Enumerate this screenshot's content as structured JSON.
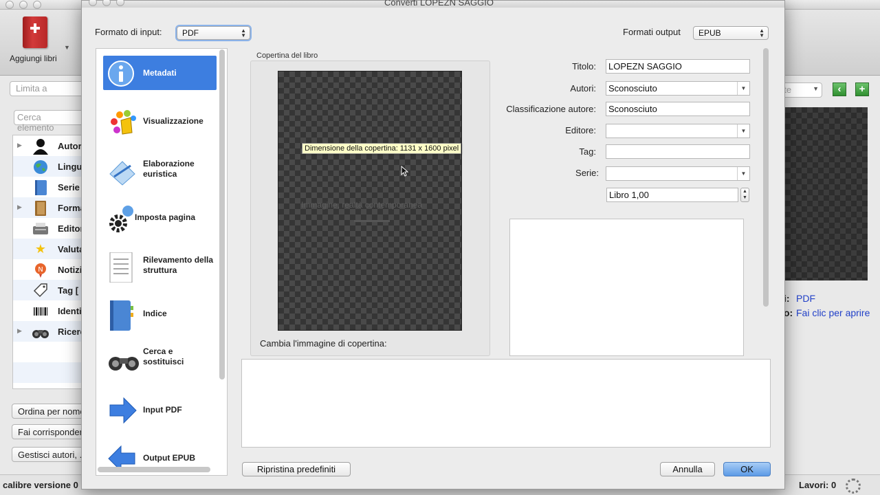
{
  "background_window": {
    "toolbar": {
      "add_books_label": "Aggiungi libri"
    },
    "limit_placeholder": "Limita a",
    "search_placeholder": "Cerca elemento",
    "tag_browser": [
      {
        "label": "Autori",
        "icon": "person-silhouette-icon",
        "expandable": true
      },
      {
        "label": "Lingue",
        "icon": "globe-icon",
        "expandable": false
      },
      {
        "label": "Serie",
        "icon": "notebook-icon",
        "expandable": false
      },
      {
        "label": "Formati",
        "icon": "book-icon",
        "expandable": true
      },
      {
        "label": "Editori",
        "icon": "typewriter-icon",
        "expandable": false
      },
      {
        "label": "Valutazione",
        "icon": "star-icon",
        "expandable": false
      },
      {
        "label": "Notizie",
        "icon": "news-icon",
        "expandable": false
      },
      {
        "label": "Tag [",
        "icon": "tag-icon",
        "expandable": false
      },
      {
        "label": "Identificatori",
        "icon": "barcode-icon",
        "expandable": false
      },
      {
        "label": "Ricerche",
        "icon": "binoculars-icon",
        "expandable": true
      }
    ],
    "sort_button": "Ordina per nome",
    "match_button": "Fai corrispondere",
    "manage_button": "Gestisci autori, ...",
    "calibre_version": "calibre versione 0",
    "jobs_label": "Lavori: 0",
    "right_combo": "ate",
    "details": {
      "formats_key": "i:",
      "formats_value": "PDF",
      "path_key": "o:",
      "path_value": "Fai clic per aprire"
    }
  },
  "dialog": {
    "title": "Converti LOPEZN SAGGIO",
    "input_format_label": "Formato di input:",
    "input_format_value": "PDF",
    "output_format_label": "Formati output",
    "output_format_value": "EPUB",
    "nav_items": [
      {
        "label": "Metadati",
        "icon": "info-icon",
        "selected": true
      },
      {
        "label": "Visualizzazione",
        "icon": "paint-palette-icon",
        "selected": false
      },
      {
        "label": "Elaborazione euristica",
        "icon": "wand-icon",
        "selected": false
      },
      {
        "label": "Imposta pagina",
        "icon": "gear-icon",
        "selected": false
      },
      {
        "label": "Rilevamento della struttura",
        "icon": "document-icon",
        "selected": false
      },
      {
        "label": "Indice",
        "icon": "notebook-icon",
        "selected": false
      },
      {
        "label": "Cerca e sostituisci",
        "icon": "binoculars-icon",
        "selected": false
      },
      {
        "label": "Input PDF",
        "icon": "arrow-right-icon",
        "selected": false
      },
      {
        "label": "Output EPUB",
        "icon": "arrow-left-icon",
        "selected": false
      }
    ],
    "cover": {
      "group_title": "Copertina del libro",
      "tooltip": "Dimensione della copertina: 1131 x 1600 pixel",
      "faint_text": "Immagine, realtà contemporanea",
      "change_label": "Cambia l'immagine di copertina:"
    },
    "form": {
      "title_label": "Titolo:",
      "title_value": "LOPEZN SAGGIO",
      "authors_label": "Autori:",
      "authors_value": "Sconosciuto",
      "author_sort_label": "Classificazione autore:",
      "author_sort_value": "Sconosciuto",
      "publisher_label": "Editore:",
      "publisher_value": "",
      "tags_label": "Tag:",
      "tags_value": "",
      "series_label": "Serie:",
      "series_value": "",
      "series_index_value": "Libro 1,00"
    },
    "buttons": {
      "restore": "Ripristina predefiniti",
      "cancel": "Annulla",
      "ok": "OK"
    },
    "colors": {
      "selection": "#3d7ee0",
      "ok_button": "#5c9ae6",
      "link": "#2140c8"
    }
  }
}
